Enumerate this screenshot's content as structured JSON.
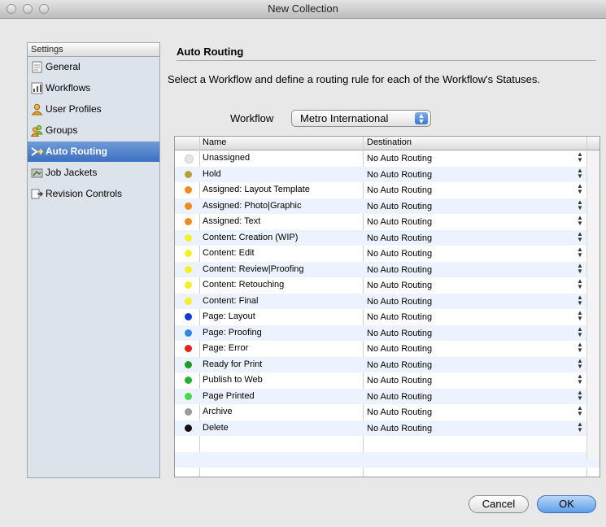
{
  "window": {
    "title": "New Collection"
  },
  "sidebar": {
    "header": "Settings",
    "items": [
      {
        "label": "General",
        "icon": "document-icon"
      },
      {
        "label": "Workflows",
        "icon": "workflow-icon"
      },
      {
        "label": "User Profiles",
        "icon": "user-icon"
      },
      {
        "label": "Groups",
        "icon": "group-icon"
      },
      {
        "label": "Auto Routing",
        "icon": "routing-icon",
        "selected": true
      },
      {
        "label": "Job Jackets",
        "icon": "job-jacket-icon"
      },
      {
        "label": "Revision Controls",
        "icon": "revision-icon"
      }
    ]
  },
  "main": {
    "title": "Auto Routing",
    "instruction": "Select a Workflow and define a routing rule for each of the Workflow's Statuses.",
    "workflow_label": "Workflow",
    "workflow_value": "Metro International",
    "table": {
      "headers": {
        "name": "Name",
        "destination": "Destination"
      },
      "rows": [
        {
          "color": "#e6e6e6",
          "name": "Unassigned",
          "destination": "No Auto Routing"
        },
        {
          "color": "#b5a03a",
          "name": "Hold",
          "destination": "No Auto Routing"
        },
        {
          "color": "#f08a24",
          "name": "Assigned: Layout Template",
          "destination": "No Auto Routing"
        },
        {
          "color": "#f08a24",
          "name": "Assigned: Photo|Graphic",
          "destination": "No Auto Routing"
        },
        {
          "color": "#f08a24",
          "name": "Assigned: Text",
          "destination": "No Auto Routing"
        },
        {
          "color": "#f3ef2a",
          "name": "Content: Creation (WIP)",
          "destination": "No Auto Routing"
        },
        {
          "color": "#f3ef2a",
          "name": "Content: Edit",
          "destination": "No Auto Routing"
        },
        {
          "color": "#f3ef2a",
          "name": "Content: Review|Proofing",
          "destination": "No Auto Routing"
        },
        {
          "color": "#f3ef2a",
          "name": "Content: Retouching",
          "destination": "No Auto Routing"
        },
        {
          "color": "#f3ef2a",
          "name": "Content: Final",
          "destination": "No Auto Routing"
        },
        {
          "color": "#1238d6",
          "name": "Page: Layout",
          "destination": "No Auto Routing"
        },
        {
          "color": "#2e86e6",
          "name": "Page: Proofing",
          "destination": "No Auto Routing"
        },
        {
          "color": "#e2231a",
          "name": "Page: Error",
          "destination": "No Auto Routing"
        },
        {
          "color": "#1e9a2a",
          "name": "Ready for Print",
          "destination": "No Auto Routing"
        },
        {
          "color": "#22b030",
          "name": "Publish to Web",
          "destination": "No Auto Routing"
        },
        {
          "color": "#48d848",
          "name": "Page Printed",
          "destination": "No Auto Routing"
        },
        {
          "color": "#9a9a9a",
          "name": "Archive",
          "destination": "No Auto Routing"
        },
        {
          "color": "#111111",
          "name": "Delete",
          "destination": "No Auto Routing"
        }
      ]
    }
  },
  "footer": {
    "cancel": "Cancel",
    "ok": "OK"
  }
}
